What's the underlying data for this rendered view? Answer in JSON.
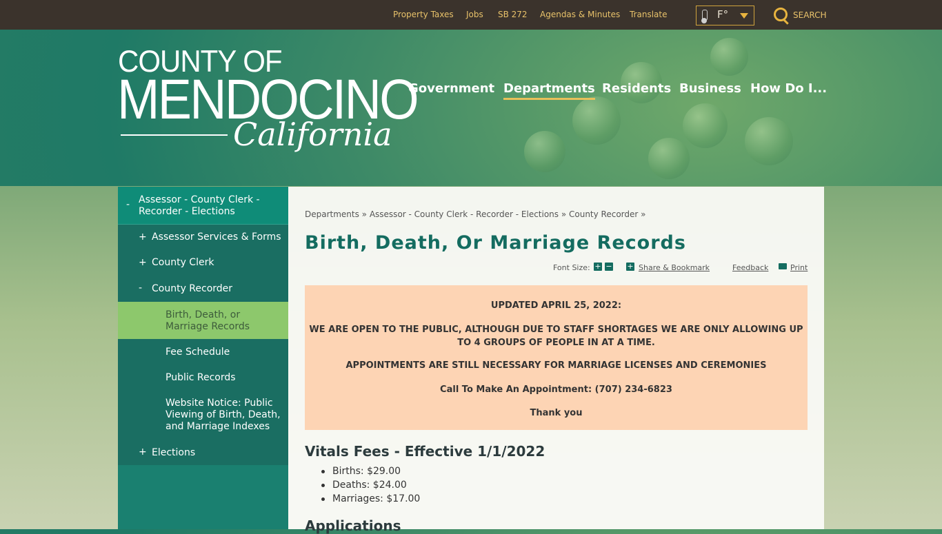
{
  "topbar": {
    "links": [
      "Property Taxes",
      "Jobs",
      "SB 272",
      "Agendas & Minutes",
      "Translate"
    ],
    "temp_unit": "F°",
    "search_label": "SEARCH"
  },
  "logo": {
    "top": "COUNTY OF",
    "main": "MENDOCINO",
    "script": "California"
  },
  "nav": [
    "Government",
    "Departments",
    "Residents",
    "Business",
    "How Do I..."
  ],
  "sidebar": {
    "section": "Assessor - County Clerk - Recorder - Elections",
    "items": [
      {
        "mark": "+",
        "label": "Assessor Services & Forms"
      },
      {
        "mark": "+",
        "label": "County Clerk"
      },
      {
        "mark": "-",
        "label": "County Recorder"
      }
    ],
    "sub_items": [
      "Birth, Death, or Marriage Records",
      "Fee Schedule",
      "Public Records",
      "Website Notice: Public Viewing of Birth, Death, and Marriage Indexes"
    ],
    "last": {
      "mark": "+",
      "label": "Elections"
    },
    "section_mark": "-"
  },
  "content": {
    "breadcrumb": "Departments » Assessor - County Clerk - Recorder - Elections » County Recorder »",
    "title": "Birth, Death, Or Marriage Records",
    "tools": {
      "font_size": "Font Size:",
      "share": "Share & Bookmark",
      "feedback": "Feedback",
      "print": "Print"
    },
    "notice": [
      "UPDATED APRIL 25, 2022:",
      "WE ARE OPEN TO THE PUBLIC, ALTHOUGH DUE TO STAFF SHORTAGES WE ARE ONLY ALLOWING UP TO 4 GROUPS OF PEOPLE IN AT A TIME.",
      "APPOINTMENTS ARE STILL NECESSARY FOR MARRIAGE LICENSES AND CEREMONIES",
      "Call To Make An Appointment: (707) 234-6823",
      "Thank you"
    ],
    "fees_heading": "Vitals Fees - Effective 1/1/2022",
    "fees": [
      "Births: $29.00",
      "Deaths: $24.00",
      "Marriages: $17.00"
    ],
    "applications_heading": "Applications"
  }
}
